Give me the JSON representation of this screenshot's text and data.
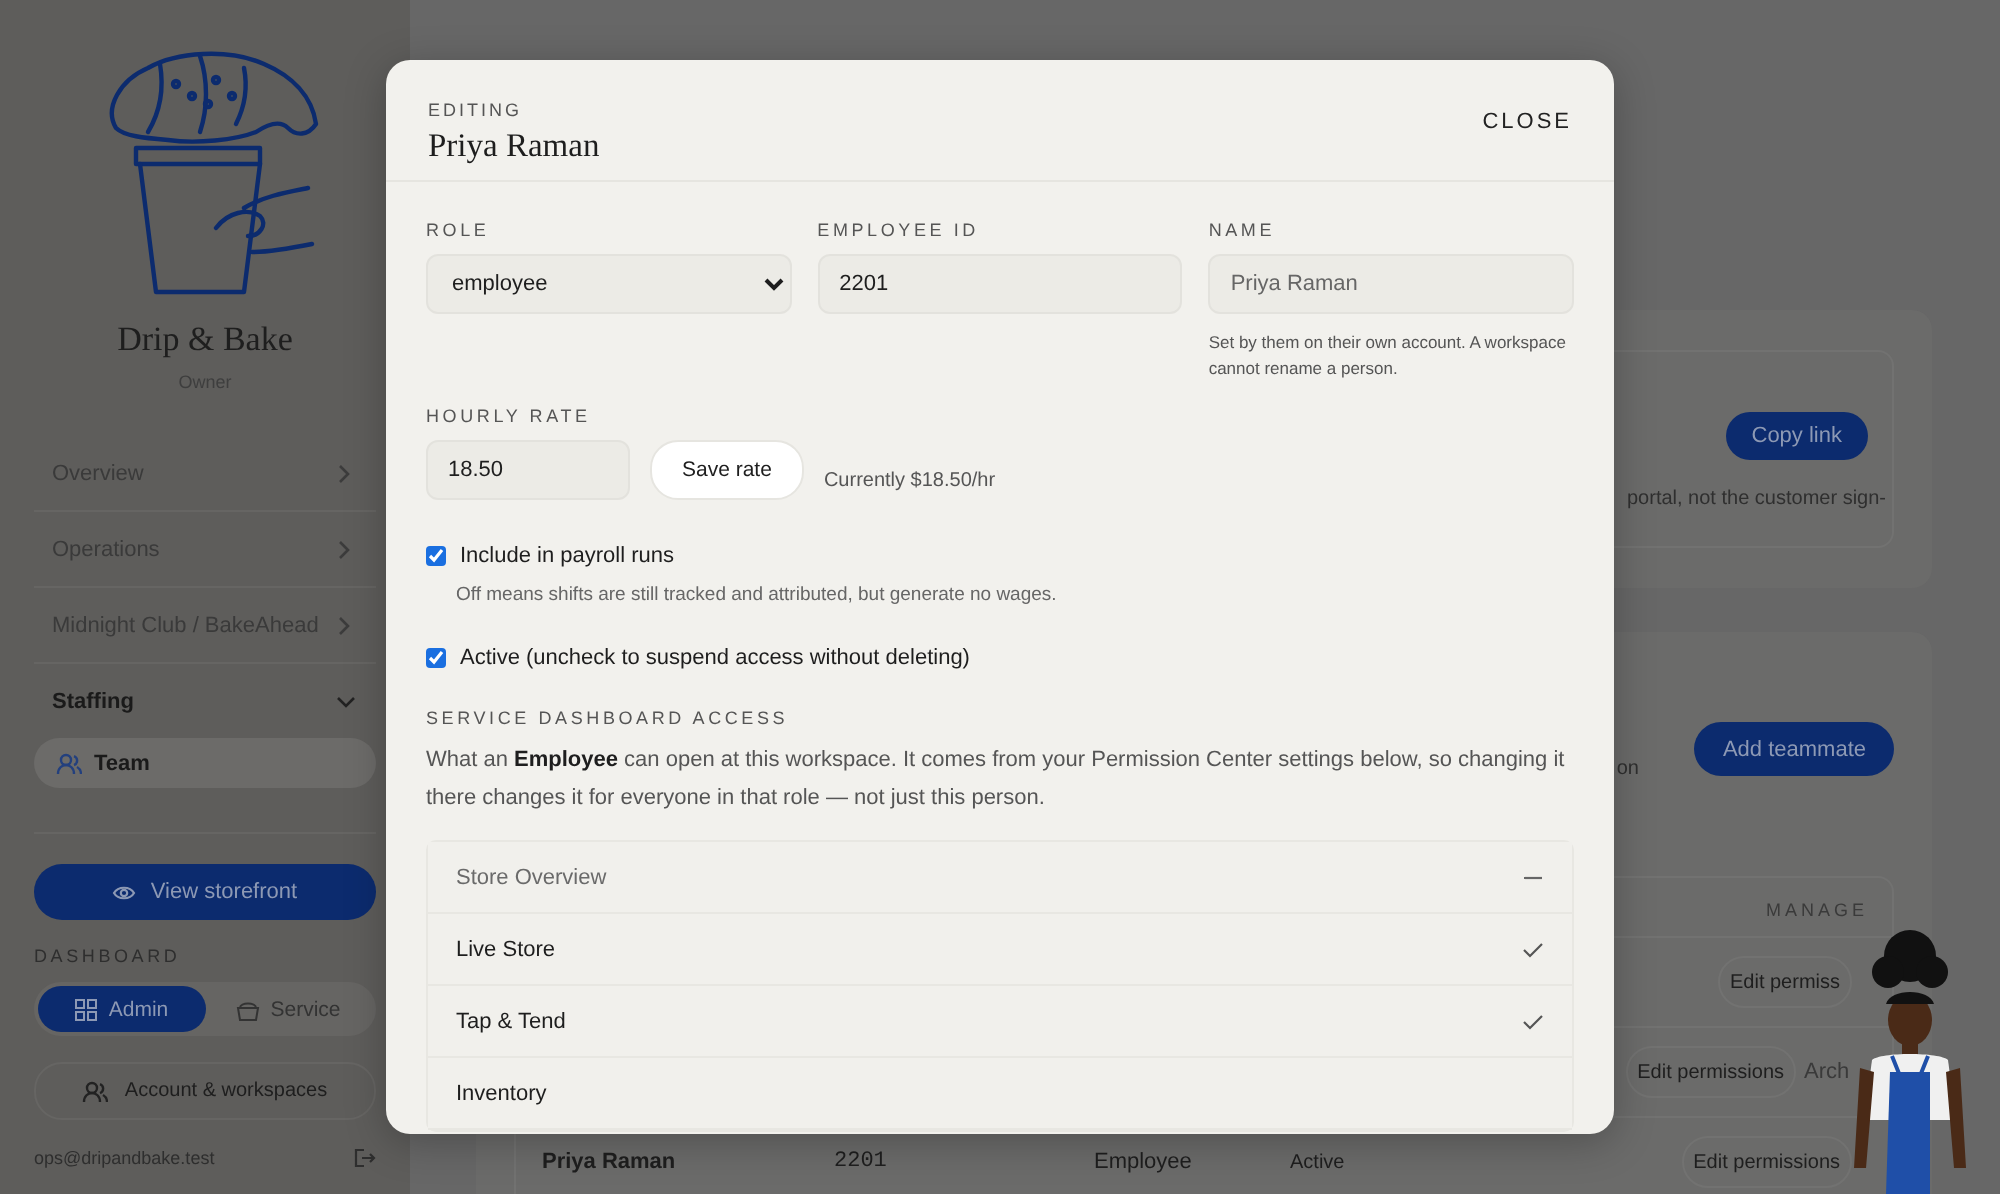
{
  "sidebar": {
    "brand": "Drip & Bake",
    "role": "Owner",
    "nav": [
      {
        "label": "Overview",
        "expanded": false
      },
      {
        "label": "Operations",
        "expanded": false
      },
      {
        "label": "Midnight Club / BakeAhead",
        "expanded": false
      },
      {
        "label": "Staffing",
        "expanded": true,
        "children": [
          {
            "label": "Team",
            "selected": true
          }
        ]
      }
    ],
    "storefront_button": "View storefront",
    "dashboard_heading": "DASHBOARD",
    "dashboard_toggle": [
      {
        "label": "Admin",
        "selected": true
      },
      {
        "label": "Service",
        "selected": false
      }
    ],
    "account_button": "Account & workspaces",
    "email": "ops@dripandbake.test"
  },
  "main": {
    "invite_card": {
      "button": "Copy link",
      "text": "portal, not the customer sign-"
    },
    "team_card": {
      "button": "Add teammate",
      "text": "on",
      "table": {
        "header": "MANAGE",
        "rows": [
          {
            "button": "Edit permiss"
          },
          {
            "button": "Edit permissions",
            "action": "Arch"
          },
          {
            "cells": [
              "Priya Raman",
              "2201",
              "Employee",
              "Active"
            ],
            "button": "Edit permissions"
          }
        ]
      }
    }
  },
  "modal": {
    "eyebrow": "EDITING",
    "title": "Priya Raman",
    "close": "CLOSE",
    "fields": [
      {
        "kind": "select",
        "label": "ROLE",
        "value": "employee"
      },
      {
        "kind": "input",
        "label": "EMPLOYEE ID",
        "value": "2201"
      },
      {
        "kind": "readonly",
        "label": "NAME",
        "value": "Priya Raman",
        "help": "Set by them on their own account. A workspace cannot rename a person."
      }
    ],
    "hourly_rate": {
      "label": "HOURLY RATE",
      "value": "18.50",
      "button": "Save rate",
      "note": "Currently $18.50/hr"
    },
    "checkboxes": [
      {
        "label": "Include in payroll runs",
        "checked": true,
        "help": "Off means shifts are still tracked and attributed, but generate no wages."
      },
      {
        "label": "Active (uncheck to suspend access without deleting)",
        "checked": true
      }
    ],
    "access": {
      "heading": "SERVICE DASHBOARD ACCESS",
      "description": "What an **Employee** can open at this workspace. It comes from your Permission Center settings below, so changing it there changes it for everyone in that role — not just this person.",
      "items": [
        {
          "label": "Store Overview",
          "allowed": false
        },
        {
          "label": "Live Store",
          "allowed": true
        },
        {
          "label": "Tap & Tend",
          "allowed": true
        },
        {
          "label": "Inventory"
        }
      ]
    }
  }
}
